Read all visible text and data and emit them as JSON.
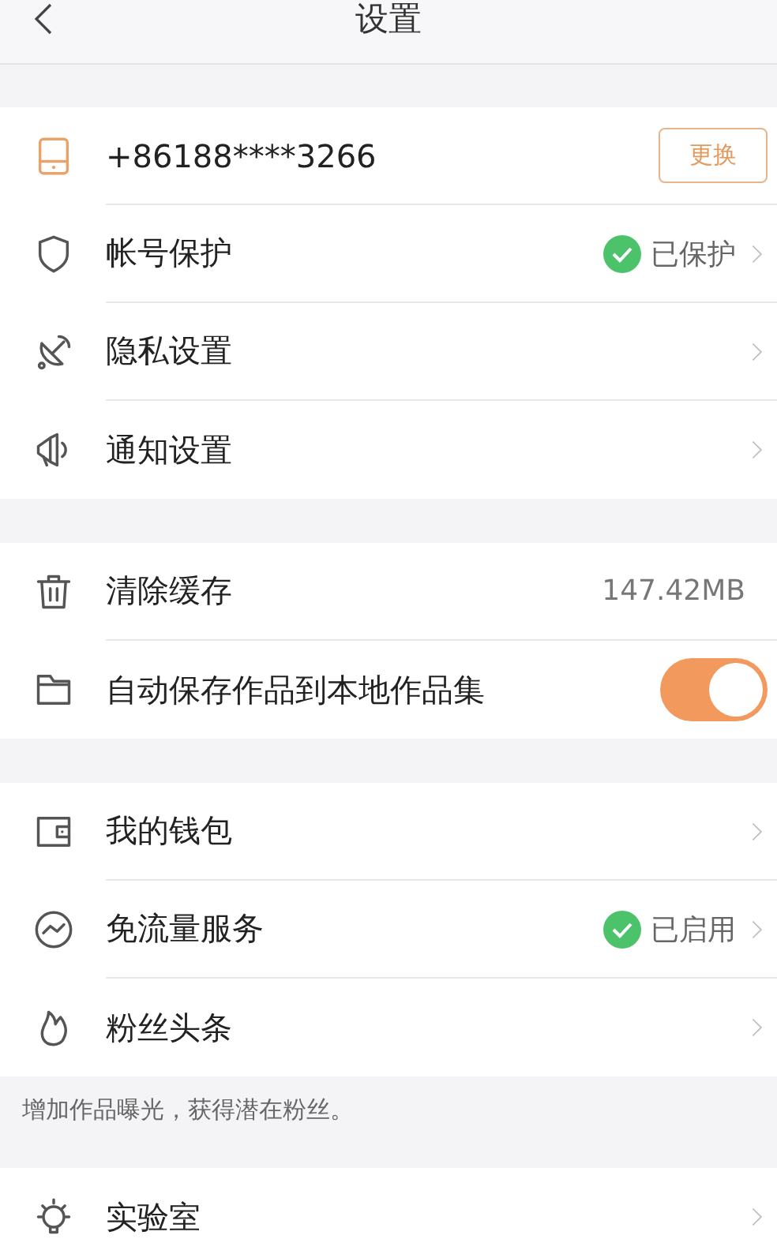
{
  "header": {
    "title": "设置"
  },
  "groups": [
    {
      "rows": [
        {
          "kind": "phone",
          "label": "+86188****3266",
          "button": "更换"
        },
        {
          "kind": "link",
          "label": "帐号保护",
          "status": "已保护"
        },
        {
          "kind": "link",
          "label": "隐私设置"
        },
        {
          "kind": "link",
          "label": "通知设置"
        }
      ]
    },
    {
      "rows": [
        {
          "kind": "value",
          "label": "清除缓存",
          "value": "147.42MB"
        },
        {
          "kind": "toggle",
          "label": "自动保存作品到本地作品集",
          "on": true
        }
      ]
    },
    {
      "rows": [
        {
          "kind": "link",
          "label": "我的钱包"
        },
        {
          "kind": "link",
          "label": "免流量服务",
          "status": "已启用"
        },
        {
          "kind": "link",
          "label": "粉丝头条"
        }
      ],
      "note": "增加作品曝光，获得潜在粉丝。"
    },
    {
      "rows": [
        {
          "kind": "link",
          "label": "实验室"
        }
      ]
    }
  ]
}
